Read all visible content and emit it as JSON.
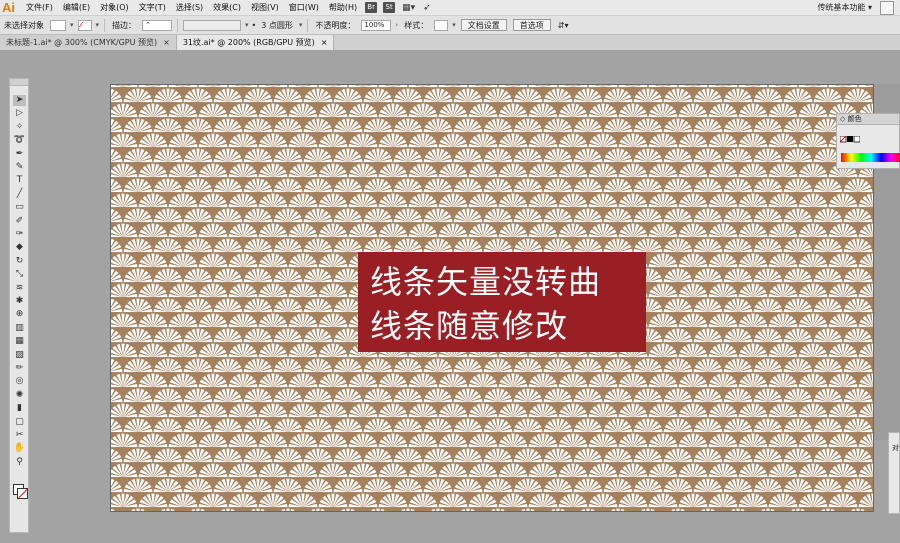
{
  "app": {
    "logo": "Ai"
  },
  "menubar": {
    "items": [
      "文件(F)",
      "编辑(E)",
      "对象(O)",
      "文字(T)",
      "选择(S)",
      "效果(C)",
      "视图(V)",
      "窗口(W)",
      "帮助(H)"
    ],
    "badges": [
      "Br",
      "St"
    ],
    "workspace": "传统基本功能 ▾"
  },
  "controlbar": {
    "selection_status": "未选择对象",
    "stroke_label": "描边：",
    "brush_label": "3 点圆形",
    "opacity_label": "不透明度：",
    "opacity_value": "100%",
    "style_label": "样式：",
    "doc_settings_button": "文档设置",
    "preferences_button": "首选项"
  },
  "tabs": [
    {
      "label": "未标题-1.ai* @ 300% (CMYK/GPU 预览)",
      "close": "×",
      "active": false
    },
    {
      "label": "31纹.ai* @ 200% (RGB/GPU 预览)",
      "close": "×",
      "active": true
    }
  ],
  "caption": {
    "line1": "线条矢量没转曲",
    "line2": "线条随意修改"
  },
  "color_panel": {
    "title": "◇ 颜色"
  },
  "right_panel_2": {
    "label": "对"
  },
  "colors": {
    "pattern_stroke": "#a5805d",
    "pattern_fill": "#ffffff",
    "caption_bg": "#9a1f25",
    "workspace_bg": "#a3a3a3"
  },
  "tools": [
    "selection-tool",
    "direct-selection-tool",
    "magic-wand-tool",
    "lasso-tool",
    "pen-tool",
    "curvature-tool",
    "type-tool",
    "line-tool",
    "rectangle-tool",
    "paintbrush-tool",
    "shaper-tool",
    "eraser-tool",
    "rotate-tool",
    "scale-tool",
    "width-tool",
    "puppet-warp-tool",
    "shape-builder-tool",
    "perspective-tool",
    "mesh-tool",
    "gradient-tool",
    "eyedropper-tool",
    "blend-tool",
    "symbol-sprayer-tool",
    "column-graph-tool",
    "artboard-tool",
    "slice-tool",
    "hand-tool",
    "zoom-tool"
  ]
}
